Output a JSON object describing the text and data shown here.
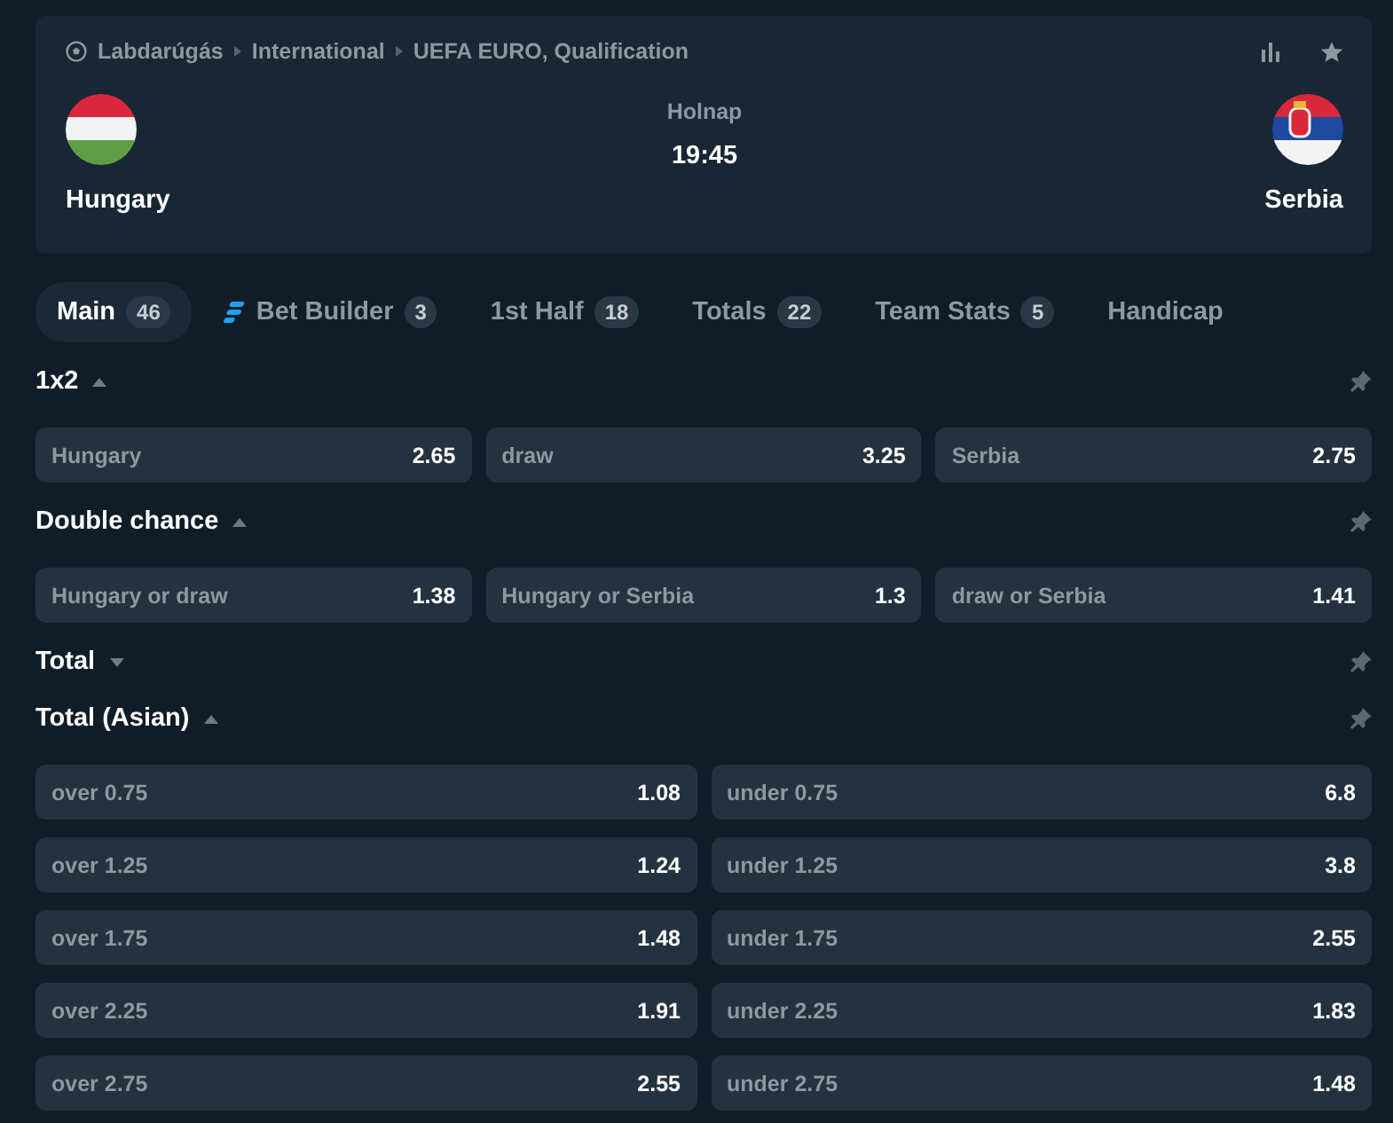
{
  "header": {
    "breadcrumbs": [
      "Labdarúgás",
      "International",
      "UEFA EURO, Qualification"
    ],
    "home": {
      "name": "Hungary",
      "kind": "hungary"
    },
    "away": {
      "name": "Serbia",
      "kind": "serbia"
    },
    "day": "Holnap",
    "time": "19:45"
  },
  "tabs": [
    {
      "label": "Main",
      "count": "46",
      "selected": true
    },
    {
      "label": "Bet Builder",
      "count": "3",
      "selected": false,
      "kind": "builder"
    },
    {
      "label": "1st Half",
      "count": "18",
      "selected": false
    },
    {
      "label": "Totals",
      "count": "22",
      "selected": false
    },
    {
      "label": "Team Stats",
      "count": "5",
      "selected": false
    },
    {
      "label": "Handicap",
      "selected": false
    }
  ],
  "markets": [
    {
      "title": "1x2",
      "expanded": true,
      "kind": "three-column",
      "outcomes": [
        {
          "label": "Hungary",
          "odds": "2.65"
        },
        {
          "label": "draw",
          "odds": "3.25"
        },
        {
          "label": "Serbia",
          "odds": "2.75"
        }
      ]
    },
    {
      "title": "Double chance",
      "expanded": true,
      "kind": "three-column",
      "outcomes": [
        {
          "label": "Hungary or draw",
          "odds": "1.38"
        },
        {
          "label": "Hungary or Serbia",
          "odds": "1.3"
        },
        {
          "label": "draw or Serbia",
          "odds": "1.41"
        }
      ]
    },
    {
      "title": "Total",
      "expanded": false
    },
    {
      "title": "Total (Asian)",
      "expanded": true,
      "kind": "two-column",
      "outcomes": [
        {
          "label": "over 0.75",
          "odds": "1.08"
        },
        {
          "label": "under 0.75",
          "odds": "6.8"
        },
        {
          "label": "over 1.25",
          "odds": "1.24"
        },
        {
          "label": "under 1.25",
          "odds": "3.8"
        },
        {
          "label": "over 1.75",
          "odds": "1.48"
        },
        {
          "label": "under 1.75",
          "odds": "2.55"
        },
        {
          "label": "over 2.25",
          "odds": "1.91"
        },
        {
          "label": "under 2.25",
          "odds": "1.83"
        },
        {
          "label": "over 2.75",
          "odds": "2.55"
        },
        {
          "label": "under 2.75",
          "odds": "1.48"
        }
      ]
    }
  ]
}
